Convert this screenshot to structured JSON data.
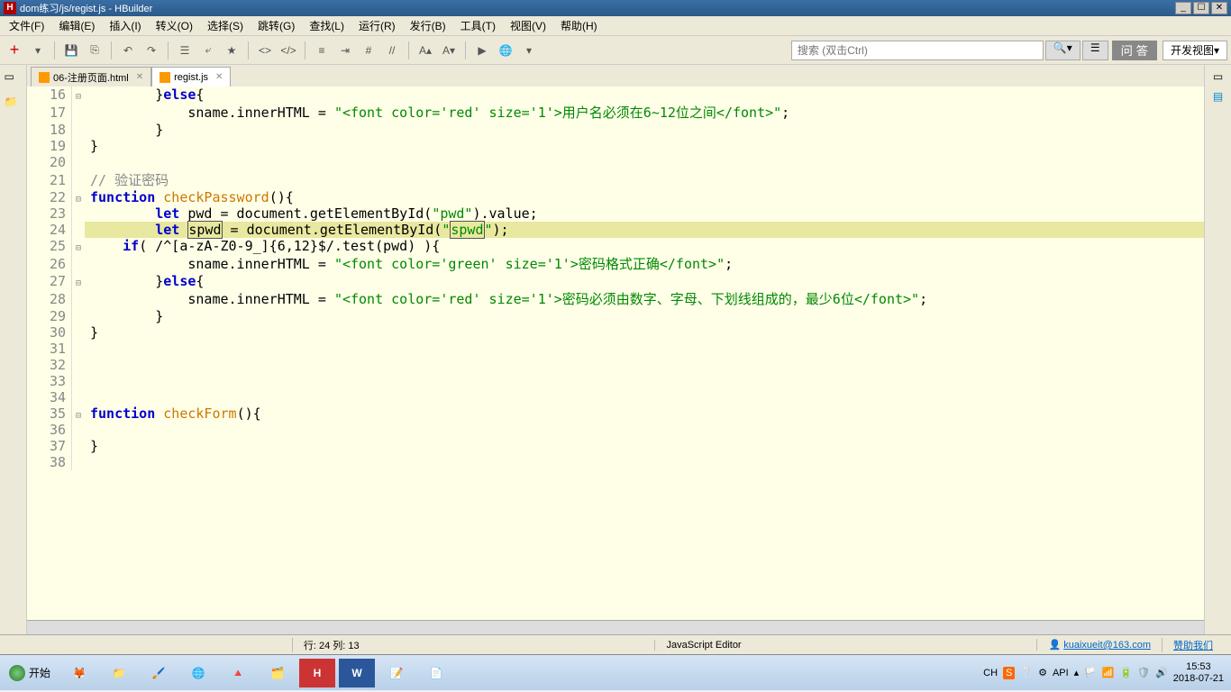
{
  "titlebar": {
    "title": "dom练习/js/regist.js - HBuilder"
  },
  "menubar": {
    "items": [
      "文件(F)",
      "编辑(E)",
      "插入(I)",
      "转义(O)",
      "选择(S)",
      "跳转(G)",
      "查找(L)",
      "运行(R)",
      "发行(B)",
      "工具(T)",
      "视图(V)",
      "帮助(H)"
    ]
  },
  "toolbar": {
    "search_placeholder": "搜索 (双击Ctrl)",
    "ask_label": "问 答",
    "view_label": "开发视图"
  },
  "tabs": [
    {
      "label": "06-注册页面.html",
      "active": false
    },
    {
      "label": "regist.js",
      "active": true
    }
  ],
  "code": {
    "lines": [
      {
        "n": 16,
        "fold": "⊟",
        "indent": 2,
        "tokens": [
          {
            "t": "}"
          },
          {
            "t": "else",
            "c": "kw"
          },
          {
            "t": "{"
          }
        ]
      },
      {
        "n": 17,
        "indent": 3,
        "tokens": [
          {
            "t": "sname.innerHTML = "
          },
          {
            "t": "\"<font color='red' size='1'>用户名必须在6~12位之间</font>\"",
            "c": "str"
          },
          {
            "t": ";"
          }
        ]
      },
      {
        "n": 18,
        "indent": 2,
        "tokens": [
          {
            "t": "}"
          }
        ]
      },
      {
        "n": 19,
        "indent": 0,
        "tokens": [
          {
            "t": "}"
          }
        ]
      },
      {
        "n": 20,
        "tokens": []
      },
      {
        "n": 21,
        "indent": 0,
        "tokens": [
          {
            "t": "// 验证密码",
            "c": "cmt"
          }
        ]
      },
      {
        "n": 22,
        "fold": "⊟",
        "indent": 0,
        "tokens": [
          {
            "t": "function ",
            "c": "kw"
          },
          {
            "t": "checkPassword",
            "c": "fn"
          },
          {
            "t": "(){"
          }
        ]
      },
      {
        "n": 23,
        "indent": 2,
        "tokens": [
          {
            "t": "let ",
            "c": "kw"
          },
          {
            "t": "pwd = document.getElementById("
          },
          {
            "t": "\"pwd\"",
            "c": "str"
          },
          {
            "t": ").value;"
          }
        ]
      },
      {
        "n": 24,
        "hl": true,
        "indent": 2,
        "tokens": [
          {
            "t": "let ",
            "c": "kw"
          },
          {
            "t": "spwd",
            "sel": true
          },
          {
            "t": " = document.getElementById("
          },
          {
            "t": "\"",
            "c": "str"
          },
          {
            "t": "spwd",
            "c": "str",
            "sel": true
          },
          {
            "t": "\"",
            "c": "str"
          },
          {
            "t": ");"
          }
        ]
      },
      {
        "n": 25,
        "fold": "⊟",
        "indent": 1,
        "tokens": [
          {
            "t": "if",
            "c": "kw"
          },
          {
            "t": "( /^[a-zA-Z0-9_]{6,12}$/.test(pwd) ){"
          }
        ]
      },
      {
        "n": 26,
        "indent": 3,
        "tokens": [
          {
            "t": "sname.innerHTML = "
          },
          {
            "t": "\"<font color='green' size='1'>密码格式正确</font>\"",
            "c": "str"
          },
          {
            "t": ";"
          }
        ]
      },
      {
        "n": 27,
        "fold": "⊟",
        "indent": 2,
        "tokens": [
          {
            "t": "}"
          },
          {
            "t": "else",
            "c": "kw"
          },
          {
            "t": "{"
          }
        ]
      },
      {
        "n": 28,
        "indent": 3,
        "tokens": [
          {
            "t": "sname.innerHTML = "
          },
          {
            "t": "\"<font color='red' size='1'>密码必须由数字、字母、下划线组成的，最少6位</font>\"",
            "c": "str"
          },
          {
            "t": ";"
          }
        ]
      },
      {
        "n": 29,
        "indent": 2,
        "tokens": [
          {
            "t": "}"
          }
        ]
      },
      {
        "n": 30,
        "indent": 0,
        "tokens": [
          {
            "t": "}"
          }
        ]
      },
      {
        "n": 31,
        "tokens": []
      },
      {
        "n": 32,
        "tokens": []
      },
      {
        "n": 33,
        "tokens": []
      },
      {
        "n": 34,
        "tokens": []
      },
      {
        "n": 35,
        "fold": "⊟",
        "indent": 0,
        "tokens": [
          {
            "t": "function ",
            "c": "kw"
          },
          {
            "t": "checkForm",
            "c": "fn"
          },
          {
            "t": "(){"
          }
        ]
      },
      {
        "n": 36,
        "tokens": []
      },
      {
        "n": 37,
        "indent": 0,
        "tokens": [
          {
            "t": "}"
          }
        ]
      },
      {
        "n": 38,
        "tokens": []
      }
    ]
  },
  "statusbar": {
    "pos": "行: 24 列: 13",
    "mode": "JavaScript Editor",
    "user": "kuaixueit@163.com",
    "sponsor": "赞助我们"
  },
  "taskbar": {
    "start": "开始",
    "tray": {
      "ch": "CH",
      "api": "API"
    },
    "clock": {
      "time": "15:53",
      "date": "2018-07-21"
    }
  }
}
